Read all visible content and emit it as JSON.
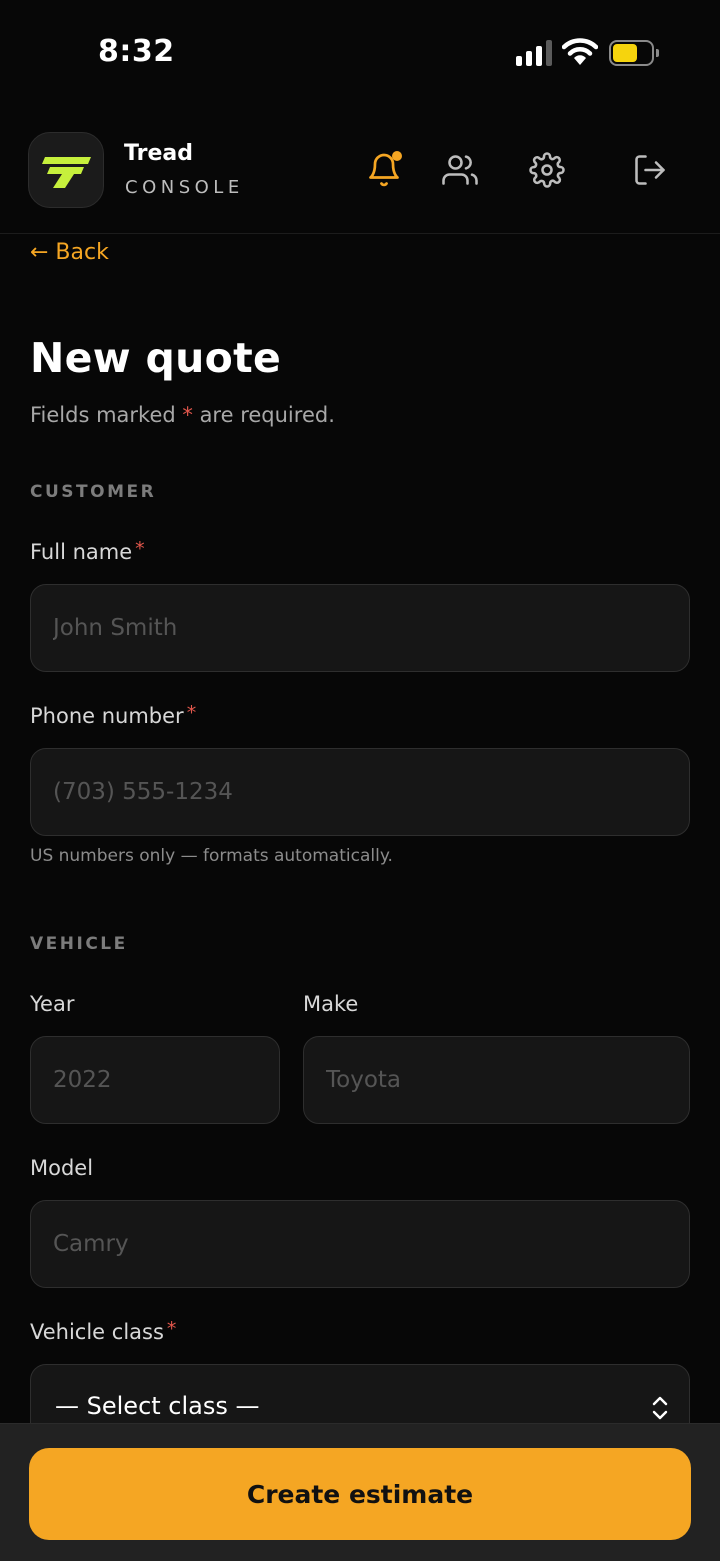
{
  "status_bar": {
    "time": "8:32",
    "signal_bars": 3,
    "battery_level": 0.55
  },
  "header": {
    "brand_name": "Tread",
    "brand_subtitle": "CONSOLE",
    "icons": [
      "notification-bell-icon",
      "users-icon",
      "gear-icon",
      "logout-icon"
    ],
    "notification_dot": true,
    "accent_color": "#f5a623"
  },
  "nav": {
    "back_label": "← Back"
  },
  "page": {
    "title": "New quote",
    "subtitle_before": "Fields marked ",
    "subtitle_star": "*",
    "subtitle_after": " are required."
  },
  "customer": {
    "section_label": "CUSTOMER",
    "full_name": {
      "label": "Full name",
      "required_mark": "*",
      "value": "",
      "placeholder": "John Smith"
    },
    "phone": {
      "label": "Phone number",
      "required_mark": "*",
      "value": "",
      "placeholder": "(703) 555-1234",
      "hint": "US numbers only — formats automatically."
    }
  },
  "vehicle": {
    "section_label": "VEHICLE",
    "year": {
      "label": "Year",
      "value": "",
      "placeholder": "2022"
    },
    "make": {
      "label": "Make",
      "value": "",
      "placeholder": "Toyota"
    },
    "model": {
      "label": "Model",
      "value": "",
      "placeholder": "Camry"
    },
    "vehicle_class": {
      "label": "Vehicle class",
      "required_mark": "*",
      "selected": "— Select class —"
    }
  },
  "actions": {
    "primary_label": "Create estimate"
  }
}
